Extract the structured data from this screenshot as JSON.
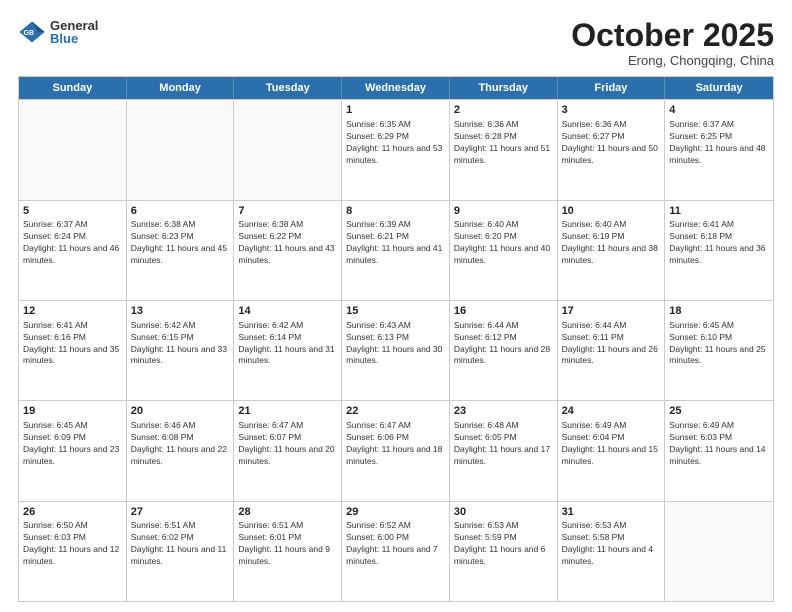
{
  "logo": {
    "general": "General",
    "blue": "Blue"
  },
  "title": "October 2025",
  "subtitle": "Erong, Chongqing, China",
  "days": [
    "Sunday",
    "Monday",
    "Tuesday",
    "Wednesday",
    "Thursday",
    "Friday",
    "Saturday"
  ],
  "weeks": [
    [
      {
        "num": "",
        "info": "",
        "empty": true
      },
      {
        "num": "",
        "info": "",
        "empty": true
      },
      {
        "num": "",
        "info": "",
        "empty": true
      },
      {
        "num": "1",
        "info": "Sunrise: 6:35 AM\nSunset: 6:29 PM\nDaylight: 11 hours and 53 minutes."
      },
      {
        "num": "2",
        "info": "Sunrise: 6:36 AM\nSunset: 6:28 PM\nDaylight: 11 hours and 51 minutes."
      },
      {
        "num": "3",
        "info": "Sunrise: 6:36 AM\nSunset: 6:27 PM\nDaylight: 11 hours and 50 minutes."
      },
      {
        "num": "4",
        "info": "Sunrise: 6:37 AM\nSunset: 6:25 PM\nDaylight: 11 hours and 48 minutes."
      }
    ],
    [
      {
        "num": "5",
        "info": "Sunrise: 6:37 AM\nSunset: 6:24 PM\nDaylight: 11 hours and 46 minutes."
      },
      {
        "num": "6",
        "info": "Sunrise: 6:38 AM\nSunset: 6:23 PM\nDaylight: 11 hours and 45 minutes."
      },
      {
        "num": "7",
        "info": "Sunrise: 6:38 AM\nSunset: 6:22 PM\nDaylight: 11 hours and 43 minutes."
      },
      {
        "num": "8",
        "info": "Sunrise: 6:39 AM\nSunset: 6:21 PM\nDaylight: 11 hours and 41 minutes."
      },
      {
        "num": "9",
        "info": "Sunrise: 6:40 AM\nSunset: 6:20 PM\nDaylight: 11 hours and 40 minutes."
      },
      {
        "num": "10",
        "info": "Sunrise: 6:40 AM\nSunset: 6:19 PM\nDaylight: 11 hours and 38 minutes."
      },
      {
        "num": "11",
        "info": "Sunrise: 6:41 AM\nSunset: 6:18 PM\nDaylight: 11 hours and 36 minutes."
      }
    ],
    [
      {
        "num": "12",
        "info": "Sunrise: 6:41 AM\nSunset: 6:16 PM\nDaylight: 11 hours and 35 minutes."
      },
      {
        "num": "13",
        "info": "Sunrise: 6:42 AM\nSunset: 6:15 PM\nDaylight: 11 hours and 33 minutes."
      },
      {
        "num": "14",
        "info": "Sunrise: 6:42 AM\nSunset: 6:14 PM\nDaylight: 11 hours and 31 minutes."
      },
      {
        "num": "15",
        "info": "Sunrise: 6:43 AM\nSunset: 6:13 PM\nDaylight: 11 hours and 30 minutes."
      },
      {
        "num": "16",
        "info": "Sunrise: 6:44 AM\nSunset: 6:12 PM\nDaylight: 11 hours and 28 minutes."
      },
      {
        "num": "17",
        "info": "Sunrise: 6:44 AM\nSunset: 6:11 PM\nDaylight: 11 hours and 26 minutes."
      },
      {
        "num": "18",
        "info": "Sunrise: 6:45 AM\nSunset: 6:10 PM\nDaylight: 11 hours and 25 minutes."
      }
    ],
    [
      {
        "num": "19",
        "info": "Sunrise: 6:45 AM\nSunset: 6:09 PM\nDaylight: 11 hours and 23 minutes."
      },
      {
        "num": "20",
        "info": "Sunrise: 6:46 AM\nSunset: 6:08 PM\nDaylight: 11 hours and 22 minutes."
      },
      {
        "num": "21",
        "info": "Sunrise: 6:47 AM\nSunset: 6:07 PM\nDaylight: 11 hours and 20 minutes."
      },
      {
        "num": "22",
        "info": "Sunrise: 6:47 AM\nSunset: 6:06 PM\nDaylight: 11 hours and 18 minutes."
      },
      {
        "num": "23",
        "info": "Sunrise: 6:48 AM\nSunset: 6:05 PM\nDaylight: 11 hours and 17 minutes."
      },
      {
        "num": "24",
        "info": "Sunrise: 6:49 AM\nSunset: 6:04 PM\nDaylight: 11 hours and 15 minutes."
      },
      {
        "num": "25",
        "info": "Sunrise: 6:49 AM\nSunset: 6:03 PM\nDaylight: 11 hours and 14 minutes."
      }
    ],
    [
      {
        "num": "26",
        "info": "Sunrise: 6:50 AM\nSunset: 6:03 PM\nDaylight: 11 hours and 12 minutes."
      },
      {
        "num": "27",
        "info": "Sunrise: 6:51 AM\nSunset: 6:02 PM\nDaylight: 11 hours and 11 minutes."
      },
      {
        "num": "28",
        "info": "Sunrise: 6:51 AM\nSunset: 6:01 PM\nDaylight: 11 hours and 9 minutes."
      },
      {
        "num": "29",
        "info": "Sunrise: 6:52 AM\nSunset: 6:00 PM\nDaylight: 11 hours and 7 minutes."
      },
      {
        "num": "30",
        "info": "Sunrise: 6:53 AM\nSunset: 5:59 PM\nDaylight: 11 hours and 6 minutes."
      },
      {
        "num": "31",
        "info": "Sunrise: 6:53 AM\nSunset: 5:58 PM\nDaylight: 11 hours and 4 minutes."
      },
      {
        "num": "",
        "info": "",
        "empty": true
      }
    ]
  ]
}
